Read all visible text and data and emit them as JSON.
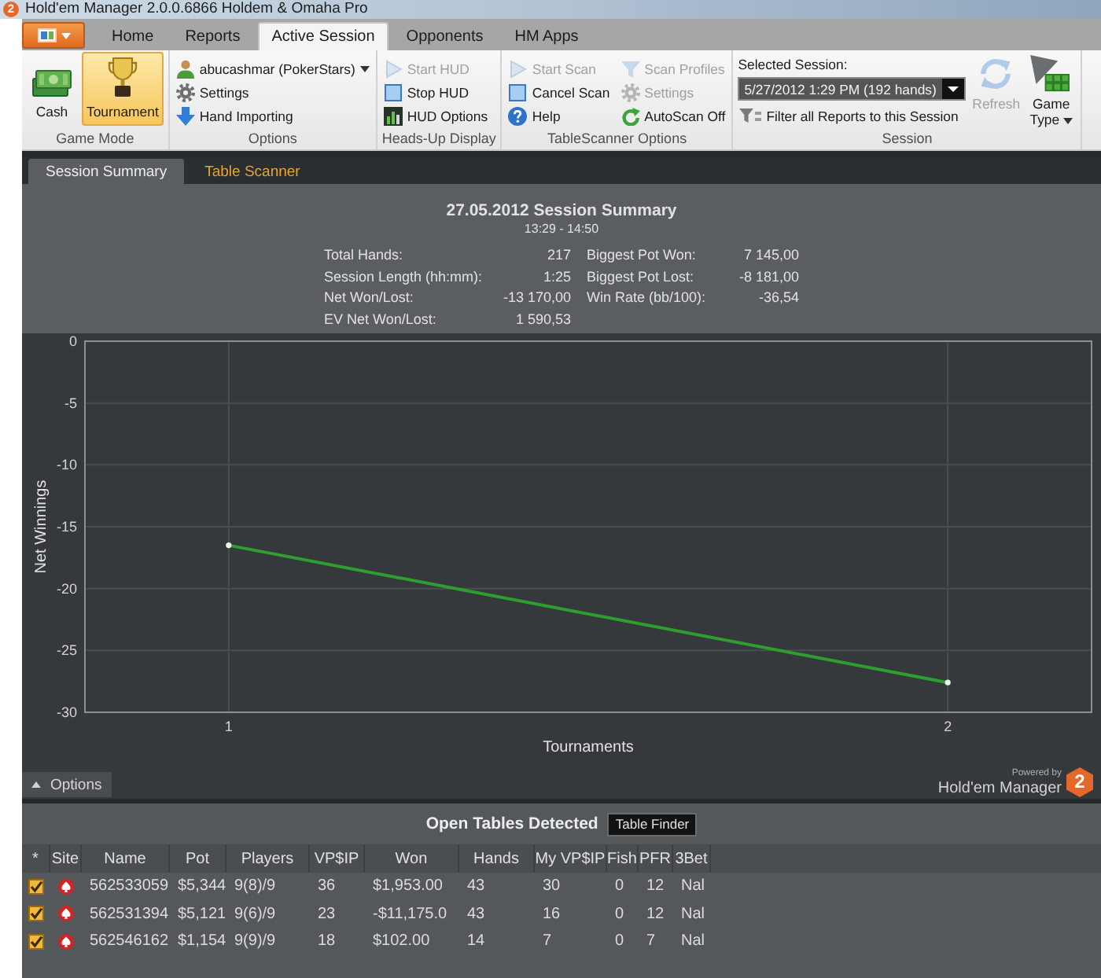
{
  "window": {
    "icon_text": "2",
    "title": "Hold'em Manager 2.0.0.6866 Holdem & Omaha Pro"
  },
  "ribbon_tabs": [
    {
      "label": "Home",
      "selected": false
    },
    {
      "label": "Reports",
      "selected": false
    },
    {
      "label": "Active Session",
      "selected": true
    },
    {
      "label": "Opponents",
      "selected": false
    },
    {
      "label": "HM Apps",
      "selected": false
    }
  ],
  "ribbon_groups": [
    {
      "kind": "mode",
      "label": "Game Mode",
      "items": [
        {
          "label": "Cash",
          "selected": false
        },
        {
          "label": "Tournament",
          "selected": true
        }
      ]
    },
    {
      "kind": "list",
      "label": "Options",
      "items": [
        {
          "label": "abucashmar (PokerStars)",
          "disabled": false,
          "dropdown": true
        },
        {
          "label": "Settings",
          "disabled": false,
          "dropdown": false
        },
        {
          "label": "Hand Importing",
          "disabled": false,
          "dropdown": false
        }
      ]
    },
    {
      "kind": "list",
      "label": "Heads-Up Display",
      "items": [
        {
          "label": "Start HUD",
          "disabled": true,
          "dropdown": false
        },
        {
          "label": "Stop HUD",
          "disabled": false,
          "dropdown": false
        },
        {
          "label": "HUD Options",
          "disabled": false,
          "dropdown": false
        }
      ]
    },
    {
      "kind": "list",
      "label": "TableScanner Options",
      "items": [
        {
          "label": "Start Scan",
          "disabled": true,
          "dropdown": false
        },
        {
          "label": "Cancel Scan",
          "disabled": false,
          "dropdown": false
        },
        {
          "label": "Help",
          "disabled": false,
          "dropdown": false
        },
        {
          "label": "Scan Profiles",
          "disabled": true,
          "dropdown": false
        },
        {
          "label": "Settings",
          "disabled": true,
          "dropdown": false
        },
        {
          "label": "AutoScan Off",
          "disabled": false,
          "dropdown": false
        }
      ]
    },
    {
      "kind": "session",
      "label": "Session",
      "field_label": "Selected Session:",
      "value": "5/27/2012 1:29 PM (192 hands)",
      "filter": "Filter all Reports to this Session",
      "items": [
        {
          "label": "Refresh",
          "disabled": true,
          "dropdown": false
        },
        {
          "label": "Game Type",
          "disabled": false,
          "dropdown": true
        }
      ]
    }
  ],
  "document_tabs": [
    {
      "label": "Session Summary",
      "selected": true
    },
    {
      "label": "Table Scanner",
      "selected": false
    }
  ],
  "summary": {
    "title": "27.05.2012 Session Summary",
    "time_range": "13:29 - 14:50",
    "stat_columns": [
      [
        {
          "label": "Total Hands:",
          "value": "217"
        },
        {
          "label": "Session Length (hh:mm):",
          "value": "1:25"
        },
        {
          "label": "Net Won/Lost:",
          "value": "-13 170,00"
        },
        {
          "label": "EV Net Won/Lost:",
          "value": "1 590,53"
        }
      ],
      [
        {
          "label": "Biggest Pot Won:",
          "value": "7 145,00"
        },
        {
          "label": "Biggest Pot Lost:",
          "value": "-8 181,00"
        },
        {
          "label": "Win Rate (bb/100):",
          "value": "-36,54"
        }
      ]
    ]
  },
  "chart": {
    "chart_data": {
      "type": "line",
      "xlabel": "Tournaments",
      "ylabel": "Net Winnings",
      "x": [
        1,
        2
      ],
      "series": [
        {
          "color": "#2e9e2e",
          "marker": "circle",
          "values": [
            -16.5,
            -27.6
          ]
        }
      ],
      "xlim": [
        0.8,
        2.2
      ],
      "ylim": [
        -30,
        0
      ],
      "xticks": [
        1,
        2
      ],
      "yticks": [
        0,
        -5,
        -10,
        -15,
        -20,
        -25,
        -30
      ],
      "grid": true
    },
    "options_button": "Options",
    "powered_by": "Powered by",
    "brand": "Hold'em Manager",
    "brand_mark": "2"
  },
  "open_tables": {
    "title": "Open Tables Detected",
    "finder_button": "Table Finder",
    "columns": [
      "*",
      "Site",
      "Name",
      "Pot",
      "Players",
      "VP$IP",
      "Won",
      "Hands",
      "My VP$IP",
      "Fish",
      "PFR",
      "3Bet"
    ],
    "rows": [
      {
        "checked": true,
        "cells": [
          "",
          "",
          "562533059",
          "$5,344",
          "9(8)/9",
          "36",
          "$1,953.00",
          "43",
          "30",
          "0",
          "12",
          "Nal"
        ]
      },
      {
        "checked": true,
        "cells": [
          "",
          "",
          "562531394",
          "$5,121",
          "9(6)/9",
          "23",
          "-$11,175.0",
          "43",
          "16",
          "0",
          "12",
          "Nal"
        ]
      },
      {
        "checked": true,
        "cells": [
          "",
          "",
          "562546162",
          "$1,154",
          "9(9)/9",
          "18",
          "$102.00",
          "14",
          "7",
          "0",
          "7",
          "Nal"
        ]
      }
    ]
  }
}
